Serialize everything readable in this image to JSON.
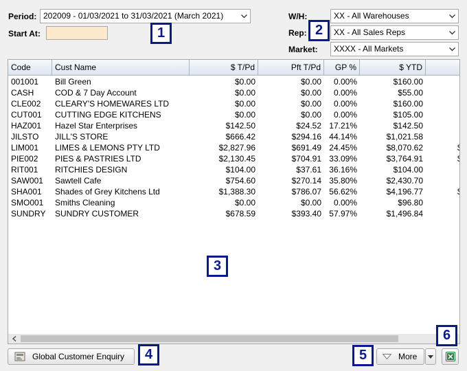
{
  "filters": {
    "period_label": "Period:",
    "period_value": "202009 - 01/03/2021 to 31/03/2021 (March 2021)",
    "start_at_label": "Start At:",
    "start_at_value": "",
    "wh_label": "W/H:",
    "wh_value": "XX - All Warehouses",
    "rep_label": "Rep:",
    "rep_value": "XX - All Sales Reps",
    "market_label": "Market:",
    "market_value": "XXXX - All Markets"
  },
  "grid": {
    "columns": [
      "Code",
      "Cust Name",
      "$ T/Pd",
      "Pft T/Pd",
      "GP %",
      "$ YTD"
    ],
    "rows": [
      {
        "code": "001001",
        "name": "Bill Green",
        "tpd": "$0.00",
        "pft": "$0.00",
        "gp": "0.00%",
        "ytd": "$160.00",
        "extra": ""
      },
      {
        "code": "CASH",
        "name": "COD & 7 Day Account",
        "tpd": "$0.00",
        "pft": "$0.00",
        "gp": "0.00%",
        "ytd": "$55.00",
        "extra": ""
      },
      {
        "code": "CLE002",
        "name": "CLEARY'S HOMEWARES LTD",
        "tpd": "$0.00",
        "pft": "$0.00",
        "gp": "0.00%",
        "ytd": "$160.00",
        "extra": ""
      },
      {
        "code": "CUT001",
        "name": "CUTTING EDGE KITCHENS",
        "tpd": "$0.00",
        "pft": "$0.00",
        "gp": "0.00%",
        "ytd": "$105.00",
        "extra": ""
      },
      {
        "code": "HAZ001",
        "name": "Hazel Star Enterprises",
        "tpd": "$142.50",
        "pft": "$24.52",
        "gp": "17.21%",
        "ytd": "$142.50",
        "extra": ""
      },
      {
        "code": "JILSTO",
        "name": "JILL'S STORE",
        "tpd": "$666.42",
        "pft": "$294.16",
        "gp": "44.14%",
        "ytd": "$1,021.58",
        "extra": ""
      },
      {
        "code": "LIM001",
        "name": "LIMES & LEMONS PTY LTD",
        "tpd": "$2,827.96",
        "pft": "$691.49",
        "gp": "24.45%",
        "ytd": "$8,070.62",
        "extra": "$:"
      },
      {
        "code": "PIE002",
        "name": "PIES & PASTRIES LTD",
        "tpd": "$2,130.45",
        "pft": "$704.91",
        "gp": "33.09%",
        "ytd": "$3,764.91",
        "extra": "$!"
      },
      {
        "code": "RIT001",
        "name": "RITCHIES DESIGN",
        "tpd": "$104.00",
        "pft": "$37.61",
        "gp": "36.16%",
        "ytd": "$104.00",
        "extra": ""
      },
      {
        "code": "SAW001",
        "name": "Sawtell Cafe",
        "tpd": "$754.60",
        "pft": "$270.14",
        "gp": "35.80%",
        "ytd": "$2,430.70",
        "extra": ""
      },
      {
        "code": "SHA001",
        "name": "Shades of Grey Kitchens Ltd",
        "tpd": "$1,388.30",
        "pft": "$786.07",
        "gp": "56.62%",
        "ytd": "$4,196.77",
        "extra": "$!"
      },
      {
        "code": "SMO001",
        "name": "Smiths Cleaning",
        "tpd": "$0.00",
        "pft": "$0.00",
        "gp": "0.00%",
        "ytd": "$96.80",
        "extra": ""
      },
      {
        "code": "SUNDRY",
        "name": "SUNDRY CUSTOMER",
        "tpd": "$678.59",
        "pft": "$393.40",
        "gp": "57.97%",
        "ytd": "$1,496.84",
        "extra": ""
      }
    ]
  },
  "buttons": {
    "global_enquiry": "Global Customer Enquiry",
    "more": "More"
  },
  "badges": [
    "1",
    "2",
    "3",
    "4",
    "5",
    "6"
  ],
  "icons": {
    "enquiry": "customer-enquiry-icon",
    "more_triangle": "triangle-down-icon",
    "more_dropdown": "chevron-down-icon",
    "excel": "excel-export-icon"
  },
  "colors": {
    "badge_border": "#0a1a8c",
    "input_bg": "#fde9cc",
    "excel_green": "#1e7b34"
  }
}
